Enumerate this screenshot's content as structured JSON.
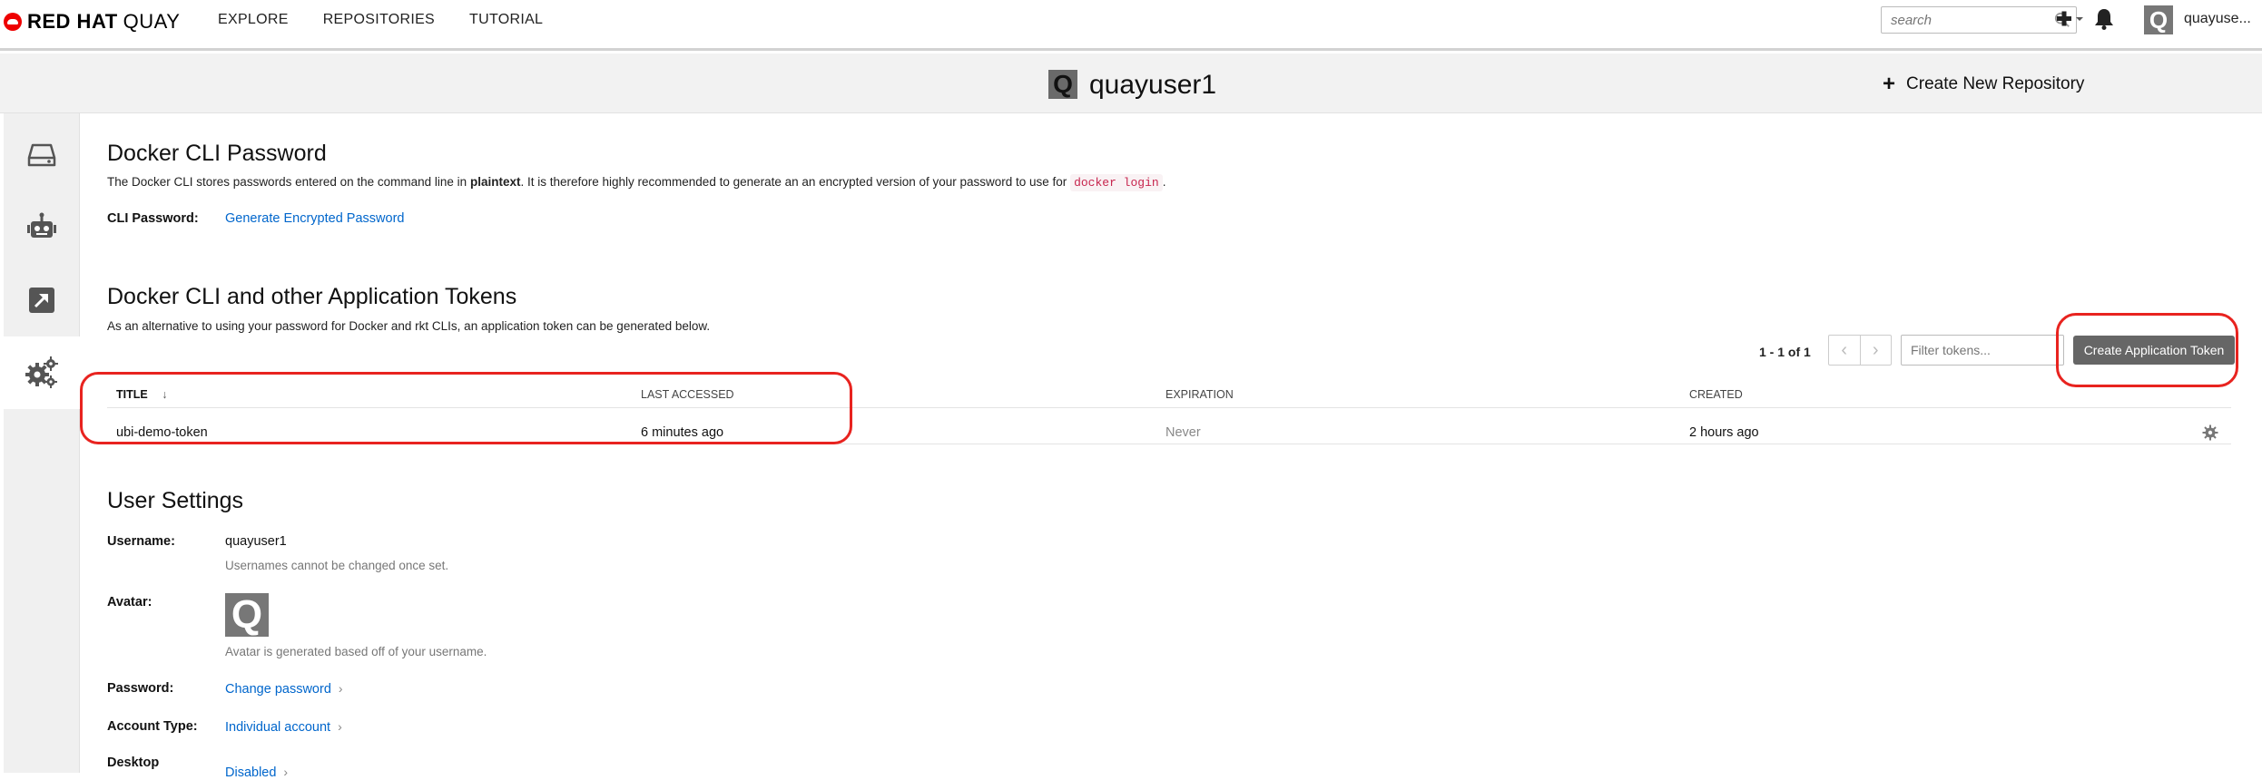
{
  "nav": {
    "brand": "RED HAT",
    "product": "QUAY",
    "links": [
      "EXPLORE",
      "REPOSITORIES",
      "TUTORIAL"
    ],
    "search_placeholder": "search",
    "username": "quayuse..."
  },
  "header": {
    "avatar_letter": "Q",
    "title": "quayuser1",
    "create_repo_label": "Create New Repository"
  },
  "cli_password": {
    "heading": "Docker CLI Password",
    "desc_pre": "The Docker CLI stores passwords entered on the command line in ",
    "desc_bold": "plaintext",
    "desc_post": ". It is therefore highly recommended to generate an an encrypted version of your password to use for ",
    "desc_code": "docker login",
    "desc_end": ".",
    "label": "CLI Password:",
    "link": "Generate Encrypted Password"
  },
  "tokens": {
    "heading": "Docker CLI and other Application Tokens",
    "desc": "As an alternative to using your password for Docker and rkt CLIs, an application token can be generated below.",
    "pager": "1 - 1 of 1",
    "filter_placeholder": "Filter tokens...",
    "create_label": "Create Application Token",
    "columns": [
      "TITLE",
      "LAST ACCESSED",
      "EXPIRATION",
      "CREATED"
    ],
    "rows": [
      {
        "title": "ubi-demo-token",
        "last_accessed": "6 minutes ago",
        "expiration": "Never",
        "created": "2 hours ago"
      }
    ]
  },
  "user_settings": {
    "heading": "User Settings",
    "username_label": "Username:",
    "username_value": "quayuser1",
    "username_help": "Usernames cannot be changed once set.",
    "avatar_label": "Avatar:",
    "avatar_letter": "Q",
    "avatar_help": "Avatar is generated based off of your username.",
    "password_label": "Password:",
    "password_link": "Change password",
    "account_type_label": "Account Type:",
    "account_type_link": "Individual account",
    "desktop_label": "Desktop",
    "desktop_link": "Disabled"
  },
  "colors": {
    "link": "#0066cc",
    "annotation": "#e8231f",
    "button": "#666666"
  }
}
